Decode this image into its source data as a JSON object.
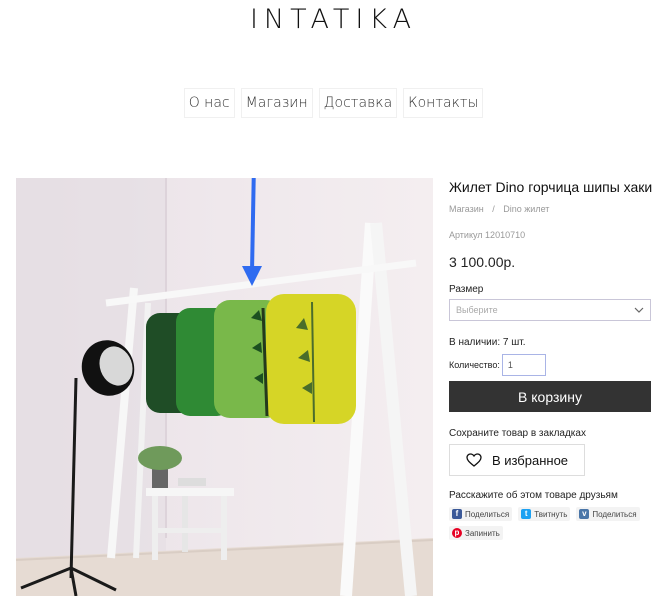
{
  "brand": {
    "logo": "INTATIKA"
  },
  "nav": {
    "items": [
      "О нас",
      "Магазин",
      "Доставка",
      "Контакты"
    ]
  },
  "product": {
    "title": "Жилет Dino горчица шипы хаки",
    "breadcrumb": [
      "Магазин",
      "/",
      "Dino жилет"
    ],
    "sku": "Артикул 12010710",
    "price": "3 100.00р.",
    "size_label": "Размер",
    "size_placeholder": "Выберите",
    "stock": "В наличии: 7 шт.",
    "quantity_label": "Количество:",
    "quantity_value": "1",
    "cart_button": "В корзину",
    "bookmark_label": "Сохраните товар в закладках",
    "favorite_button": "В избранное",
    "share_label": "Расскажите об этом товаре друзьям",
    "share": [
      {
        "label": "Поделиться",
        "icon": "facebook-icon",
        "color": "#3b5998"
      },
      {
        "label": "Твитнуть",
        "icon": "twitter-icon",
        "color": "#1da1f2"
      },
      {
        "label": "Поделиться",
        "icon": "vk-icon",
        "color": "#4a76a8"
      },
      {
        "label": "Запинить",
        "icon": "pinterest-icon",
        "color": "#e60023"
      }
    ]
  },
  "colors": {
    "accent": "#333333",
    "arrow": "#2f6bf0"
  }
}
